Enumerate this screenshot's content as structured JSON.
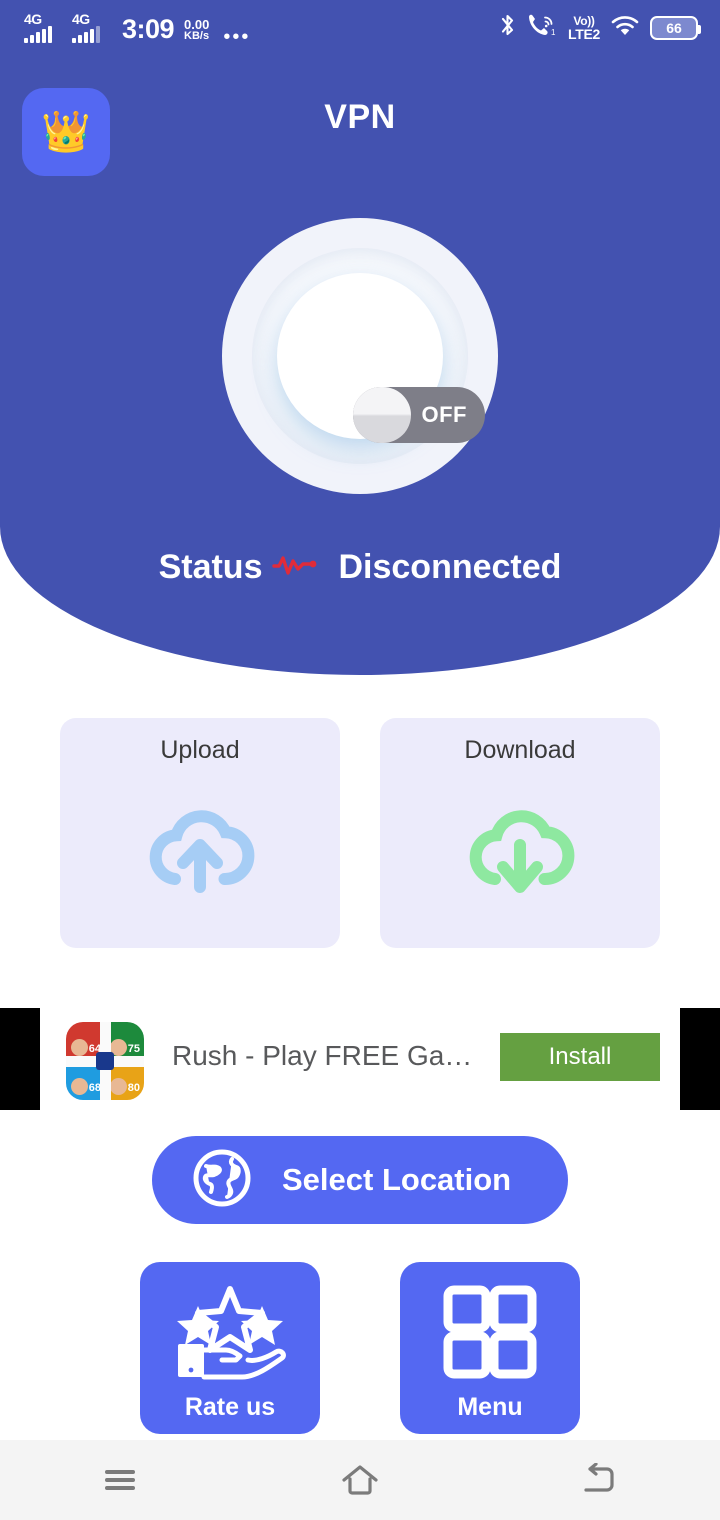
{
  "status_bar": {
    "network_1": "4G",
    "network_2": "4G",
    "time": "3:09",
    "net_speed_value": "0.00",
    "net_speed_unit": "KB/s",
    "overflow": "•••",
    "bluetooth_icon": "bluetooth-icon",
    "wifi_calling_icon": "wifi-calling-icon",
    "volte_line1": "Vo))",
    "volte_line2": "LTE2",
    "wifi_icon": "wifi-icon",
    "battery_percent": "66"
  },
  "header": {
    "premium_icon": "👑",
    "title": "VPN"
  },
  "power": {
    "toggle_label": "OFF",
    "state": "off"
  },
  "status": {
    "label": "Status",
    "value": "Disconnected",
    "pulse_color": "#e02b3a"
  },
  "speed_cards": [
    {
      "title": "Upload",
      "icon": "cloud-upload-icon",
      "color": "#a6cdf5"
    },
    {
      "title": "Download",
      "icon": "cloud-download-icon",
      "color": "#8ee8a0"
    }
  ],
  "ad": {
    "app_name": "Rush - Play FREE Ga…",
    "install_label": "Install",
    "install_color": "#65a041",
    "icon_quadrants": [
      {
        "color": "#d0392f",
        "score": "64"
      },
      {
        "color": "#1d8a3c",
        "score": "75"
      },
      {
        "color": "#1f9ce0",
        "score": "68"
      },
      {
        "color": "#e8a317",
        "score": "80"
      }
    ]
  },
  "select_location": {
    "label": "Select Location",
    "icon": "globe-icon",
    "color": "#5468f2"
  },
  "tiles": [
    {
      "label": "Rate us",
      "icon": "hand-stars-icon"
    },
    {
      "label": "Menu",
      "icon": "grid-menu-icon"
    }
  ],
  "nav_bar": {
    "recents": "menu-icon",
    "home": "home-icon",
    "back": "back-icon"
  },
  "colors": {
    "primary_blue": "#4352b0",
    "accent_blue": "#5468f2",
    "card_bg": "#ecebfb"
  }
}
